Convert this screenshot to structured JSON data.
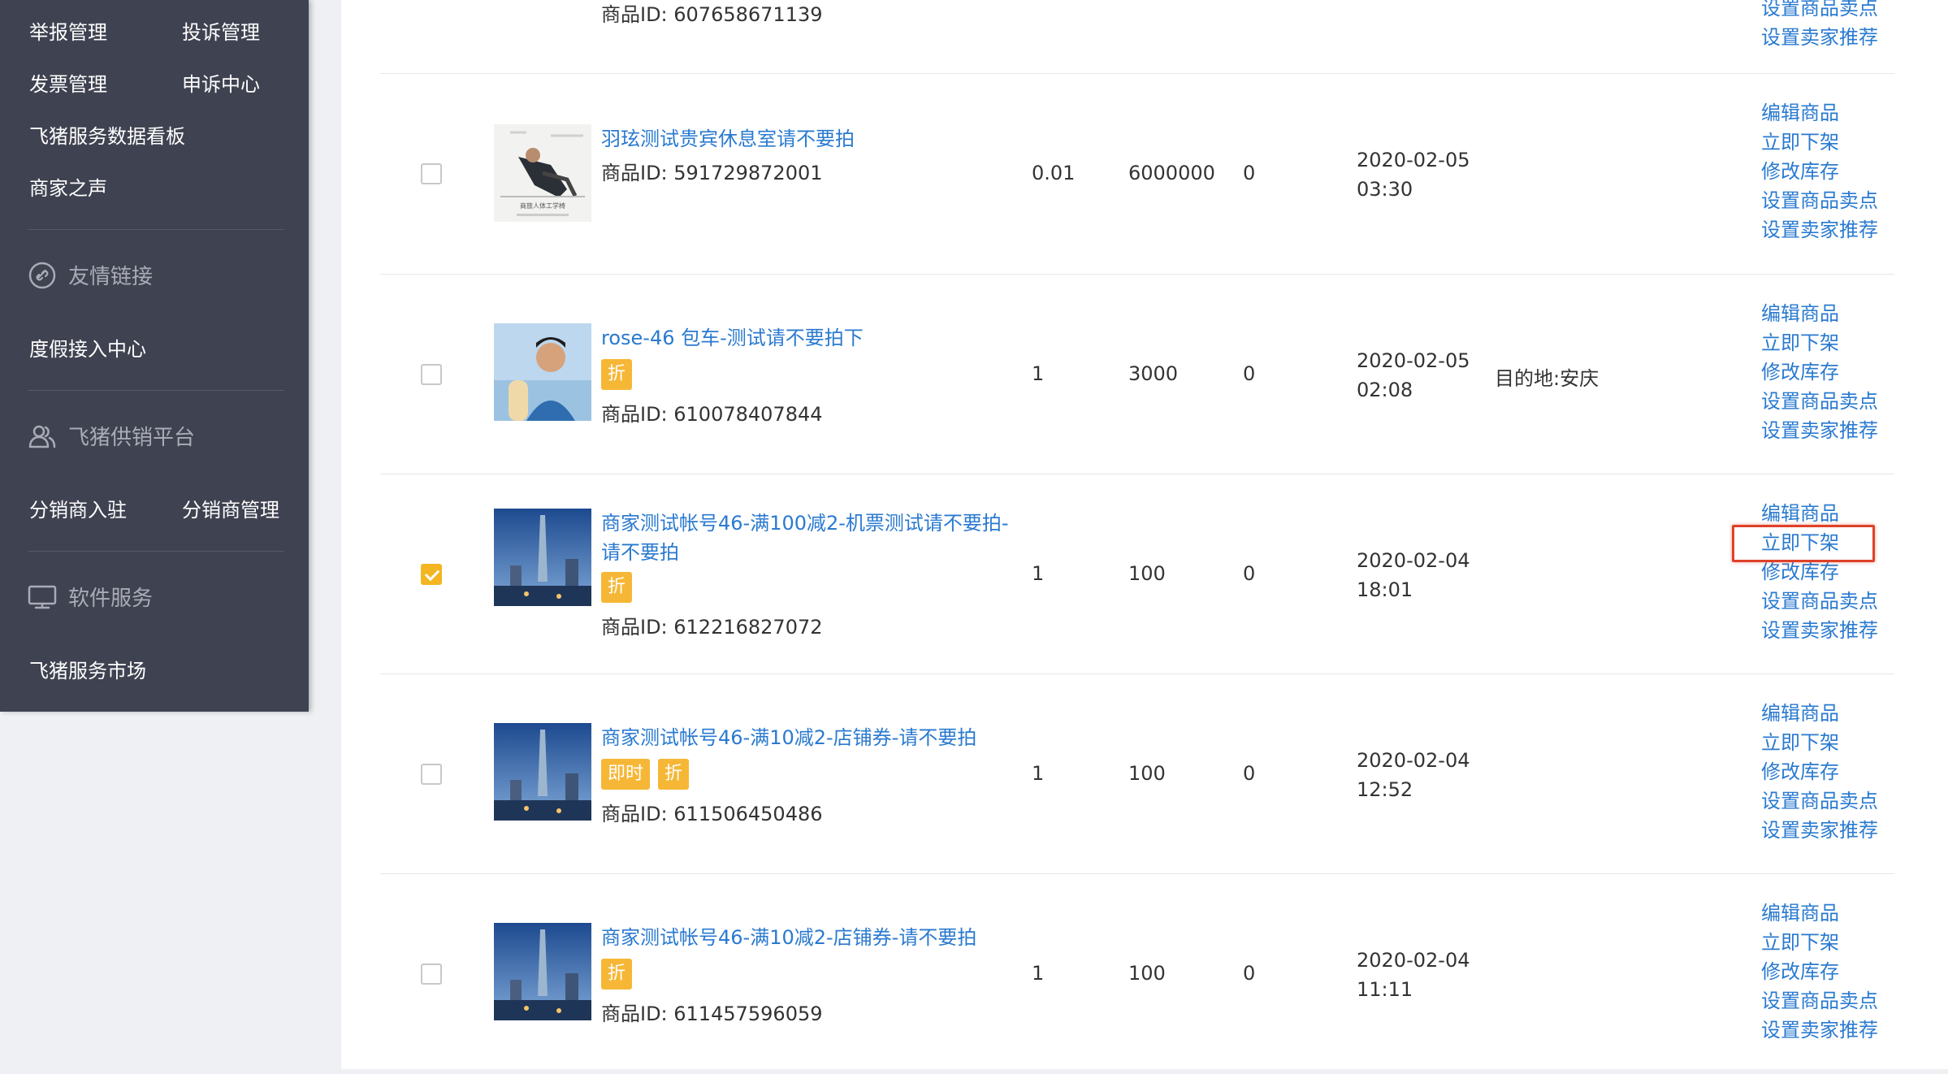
{
  "sidebar": {
    "top_items": [
      {
        "label": "举报管理"
      },
      {
        "label": "投诉管理"
      },
      {
        "label": "发票管理"
      },
      {
        "label": "申诉中心"
      },
      {
        "label": "飞猪服务数据看板"
      },
      {
        "label": "商家之声"
      }
    ],
    "section_links": {
      "title": "友情链接",
      "icon": "link-icon",
      "items": [
        {
          "label": "度假接入中心"
        }
      ]
    },
    "section_distribution": {
      "title": "飞猪供销平台",
      "icon": "users-icon",
      "items": [
        {
          "label": "分销商入驻"
        },
        {
          "label": "分销商管理"
        }
      ]
    },
    "section_software": {
      "title": "软件服务",
      "icon": "monitor-icon",
      "items": [
        {
          "label": "飞猪服务市场"
        }
      ]
    }
  },
  "partial_row": {
    "product_id": "商品ID: 607658671139",
    "actions": [
      "设置商品卖点",
      "设置卖家推荐"
    ]
  },
  "rows": [
    {
      "title": "羽玹测试贵宾休息室请不要拍",
      "tags": [],
      "product_id": "商品ID: 591729872001",
      "price": "0.01",
      "stock": "6000000",
      "sales": "0",
      "date": "2020-02-05",
      "time": "03:30",
      "extra": "",
      "checked": false,
      "thumb": "lounge-photo",
      "thumb_caption": "商旅人体工学椅",
      "actions": [
        "编辑商品",
        "立即下架",
        "修改库存",
        "设置商品卖点",
        "设置卖家推荐"
      ]
    },
    {
      "title": "rose-46 包车-测试请不要拍下",
      "tags": [
        "折"
      ],
      "product_id": "商品ID: 610078407844",
      "price": "1",
      "stock": "3000",
      "sales": "0",
      "date": "2020-02-05",
      "time": "02:08",
      "extra": "目的地:安庆",
      "checked": false,
      "thumb": "person-photo",
      "actions": [
        "编辑商品",
        "立即下架",
        "修改库存",
        "设置商品卖点",
        "设置卖家推荐"
      ]
    },
    {
      "title": "商家测试帐号46-满100减2-机票测试请不要拍-请不要拍",
      "tags": [
        "折"
      ],
      "product_id": "商品ID: 612216827072",
      "price": "1",
      "stock": "100",
      "sales": "0",
      "date": "2020-02-04",
      "time": "18:01",
      "extra": "",
      "checked": true,
      "thumb": "city-photo",
      "actions": [
        "编辑商品",
        "立即下架",
        "修改库存",
        "设置商品卖点",
        "设置卖家推荐"
      ]
    },
    {
      "title": "商家测试帐号46-满10减2-店铺券-请不要拍",
      "tags": [
        "即时",
        "折"
      ],
      "product_id": "商品ID: 611506450486",
      "price": "1",
      "stock": "100",
      "sales": "0",
      "date": "2020-02-04",
      "time": "12:52",
      "extra": "",
      "checked": false,
      "thumb": "city-photo",
      "actions": [
        "编辑商品",
        "立即下架",
        "修改库存",
        "设置商品卖点",
        "设置卖家推荐"
      ]
    },
    {
      "title": "商家测试帐号46-满10减2-店铺券-请不要拍",
      "tags": [
        "折"
      ],
      "product_id": "商品ID: 611457596059",
      "price": "1",
      "stock": "100",
      "sales": "0",
      "date": "2020-02-04",
      "time": "11:11",
      "extra": "",
      "checked": false,
      "thumb": "city-photo",
      "actions": [
        "编辑商品",
        "立即下架",
        "修改库存",
        "设置商品卖点",
        "设置卖家推荐"
      ]
    }
  ],
  "colors": {
    "link": "#2a7ad0",
    "tag": "#f6b736",
    "checkbox_checked": "#f3b521",
    "highlight_box": "#e0412a",
    "sidebar_bg": "#3f4250"
  }
}
